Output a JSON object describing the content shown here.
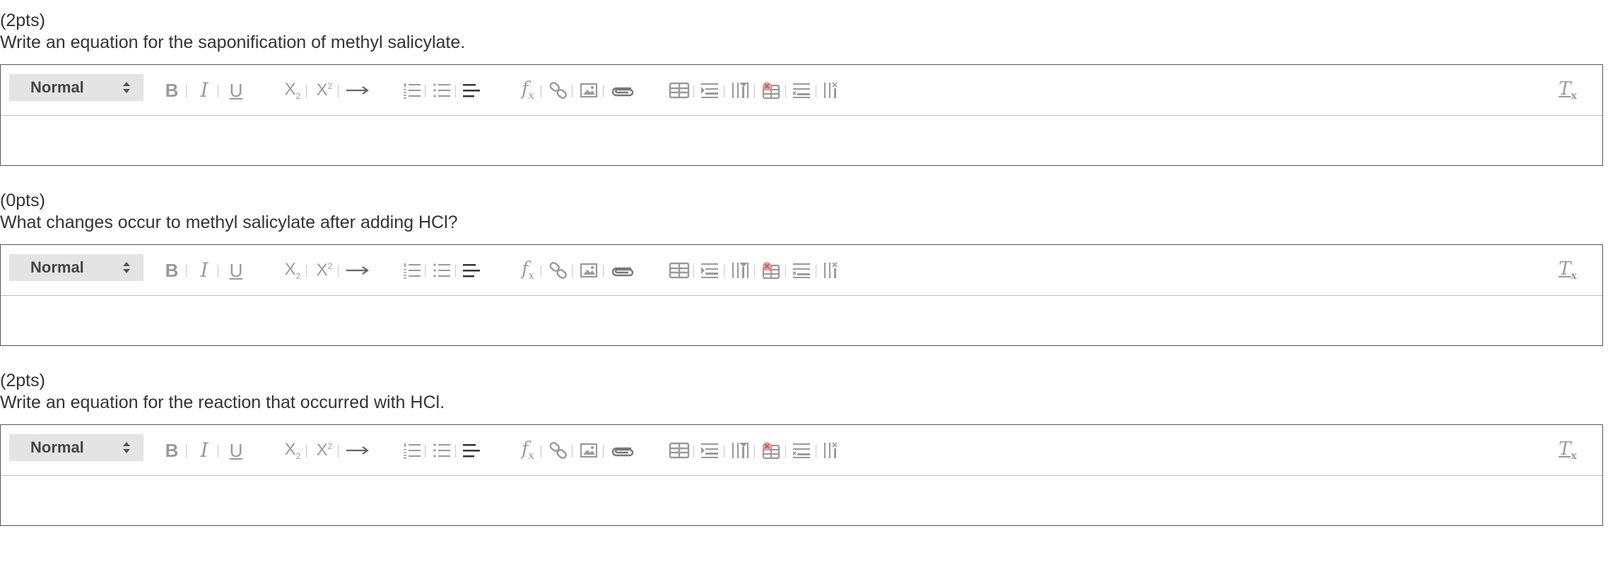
{
  "questions": [
    {
      "points": "(2pts)",
      "prompt": "Write an equation for the saponification of methyl salicylate.",
      "editor": {
        "format_value": "Normal",
        "content": ""
      }
    },
    {
      "points": "(0pts)",
      "prompt": "What changes occur to methyl salicylate after adding HCl?",
      "editor": {
        "format_value": "Normal",
        "content": ""
      }
    },
    {
      "points": "(2pts)",
      "prompt": "Write an equation for the reaction that occurred with HCl.",
      "editor": {
        "format_value": "Normal",
        "content": ""
      }
    }
  ],
  "toolbar_icons": [
    "bold-icon",
    "italic-icon",
    "underline-icon",
    "subscript-icon",
    "superscript-icon",
    "arrow-right-icon",
    "ordered-list-icon",
    "bullet-list-icon",
    "align-left-icon",
    "formula-icon",
    "link-icon",
    "image-icon",
    "attachment-icon",
    "table-icon",
    "insert-row-icon",
    "insert-column-icon",
    "delete-table-icon",
    "delete-row-icon",
    "delete-column-icon",
    "clear-formatting-icon"
  ],
  "colors": {
    "icon": "#9a9a9a",
    "border": "#555555",
    "select_bg": "#e4e4e4",
    "text": "#333333"
  }
}
